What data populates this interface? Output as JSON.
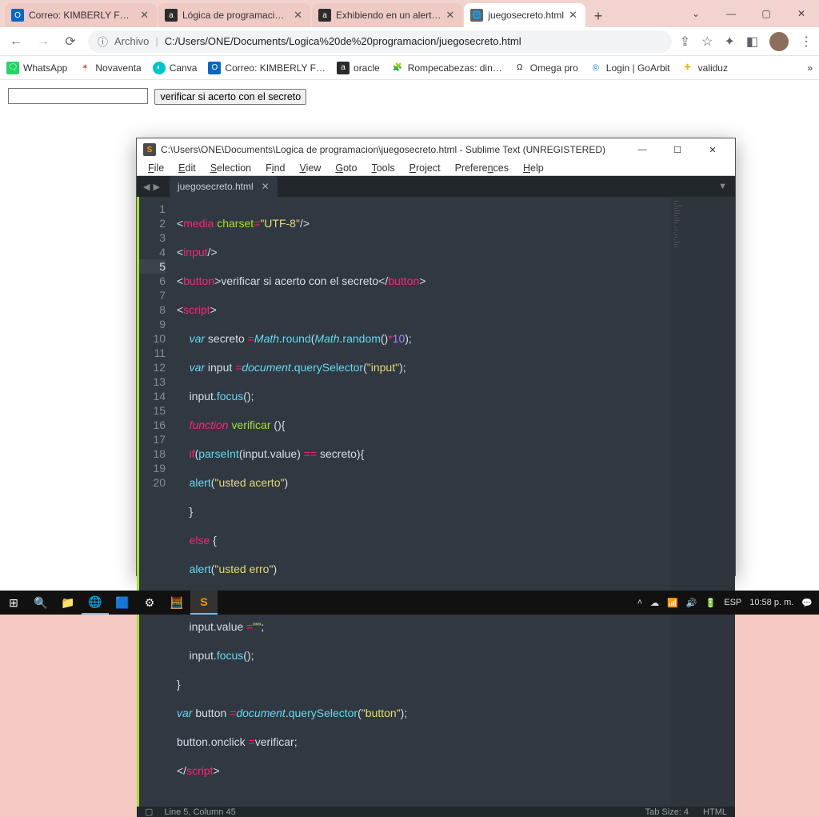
{
  "browser": {
    "tabs": [
      {
        "label": "Correo: KIMBERLY FR - …",
        "icon_bg": "#0a66c2",
        "icon_txt": "O"
      },
      {
        "label": "Lógica de programació…",
        "icon_bg": "#2b2b2b",
        "icon_txt": "a"
      },
      {
        "label": "Exhibiendo en un alert…",
        "icon_bg": "#2b2b2b",
        "icon_txt": "a"
      },
      {
        "label": "juegosecreto.html",
        "icon_bg": "#5f6368",
        "icon_txt": "◉"
      }
    ],
    "active_tab_index": 3,
    "omnibox": {
      "prefix": "Archivo",
      "url": "C:/Users/ONE/Documents/Logica%20de%20programacion/juegosecreto.html"
    },
    "bookmarks": [
      {
        "label": "WhatsApp",
        "bg": "#25d366",
        "txt": "🗨"
      },
      {
        "label": "Novaventa",
        "bg": "#e53935",
        "txt": "✦"
      },
      {
        "label": "Canva",
        "bg": "#00c4cc",
        "txt": "◐"
      },
      {
        "label": "Correo: KIMBERLY F…",
        "bg": "#0a66c2",
        "txt": "O"
      },
      {
        "label": "oracle",
        "bg": "#2b2b2b",
        "txt": "a"
      },
      {
        "label": "Rompecabezas: din…",
        "bg": "#fbbc04",
        "txt": "🧩"
      },
      {
        "label": "Omega pro",
        "bg": "#222",
        "txt": "Ω"
      },
      {
        "label": "Login | GoArbit",
        "bg": "#0288d1",
        "txt": "◎"
      },
      {
        "label": "validuz",
        "bg": "#ffeb3b",
        "txt": "✚"
      }
    ],
    "page": {
      "button_label": "verificar si acerto con el secreto"
    }
  },
  "sublime": {
    "title": "C:\\Users\\ONE\\Documents\\Logica de programacion\\juegosecreto.html - Sublime Text (UNREGISTERED)",
    "menu": [
      "File",
      "Edit",
      "Selection",
      "Find",
      "View",
      "Goto",
      "Tools",
      "Project",
      "Preferences",
      "Help"
    ],
    "tab": "juegosecreto.html",
    "status": {
      "left": "Line 5, Column 45",
      "tabsize": "Tab Size: 4",
      "lang": "HTML"
    },
    "lines": [
      "1",
      "2",
      "3",
      "4",
      "5",
      "6",
      "7",
      "8",
      "9",
      "10",
      "11",
      "12",
      "13",
      "14",
      "15",
      "16",
      "17",
      "18",
      "19",
      "20"
    ],
    "current_line_index": 4
  },
  "taskbar": {
    "lang": "ESP",
    "time": "10:58 p. m."
  }
}
